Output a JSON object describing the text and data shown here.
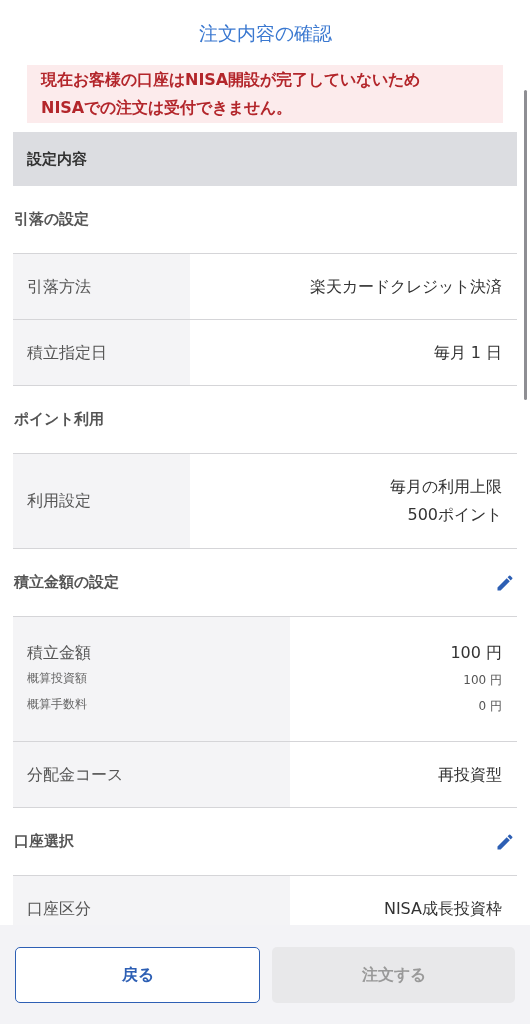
{
  "title": "注文内容の確認",
  "notice": [
    "現在お客様の口座はNISA開設が完了していないため",
    "NISAでの注文は受付できません。"
  ],
  "panel_header": "設定内容",
  "sections": [
    {
      "title": "引落の設定",
      "editable": false,
      "rows": [
        {
          "label": "引落方法",
          "value": [
            "楽天カードクレジット決済"
          ]
        },
        {
          "label": "積立指定日",
          "value": [
            "毎月 1 日"
          ]
        }
      ]
    },
    {
      "title": "ポイント利用",
      "editable": false,
      "rows": [
        {
          "label": "利用設定",
          "value": [
            "毎月の利用上限",
            "500ポイント"
          ]
        }
      ]
    },
    {
      "title": "積立金額の設定",
      "editable": true,
      "rows": [
        {
          "label": "積立金額",
          "value": [
            "100 円"
          ],
          "details": [
            {
              "label": "概算投資額",
              "value": "100 円"
            },
            {
              "label": "概算手数料",
              "value": "0 円"
            }
          ]
        },
        {
          "label": "分配金コース",
          "value": [
            "再投資型"
          ]
        }
      ]
    },
    {
      "title": "口座選択",
      "editable": true,
      "rows": [
        {
          "label": "口座区分",
          "value": [
            "NISA成長投資枠"
          ]
        }
      ]
    }
  ],
  "buttons": [
    {
      "label": "戻る",
      "disabled": false
    },
    {
      "label": "注文する",
      "disabled": true
    }
  ]
}
